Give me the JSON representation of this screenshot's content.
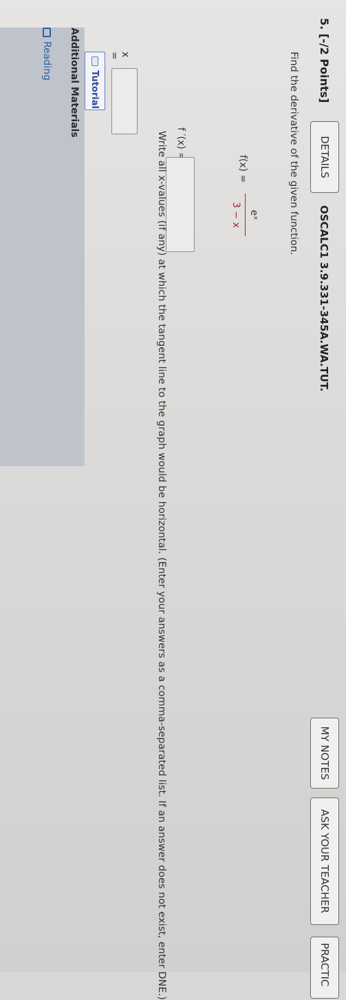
{
  "question": {
    "number_label": "5.  [-/2 Points]",
    "details_label": "DETAILS",
    "code": "OSCALC1 3.9.331-345A.WA.TUT.",
    "my_notes_label": "MY NOTES",
    "ask_teacher_label": "ASK YOUR TEACHER",
    "practice_label": "PRACTIC"
  },
  "problem": {
    "prompt": "Find the derivative of the given function.",
    "fx_label": "f(x) =",
    "numerator": "eˣ",
    "denominator": "3 − x",
    "fprime_label": "f ′(x) =",
    "fprime_value": "",
    "write_prompt": "Write all x-values (if any) at which the tangent line to the graph would be horizontal. (Enter your answers as a comma-separated list. If an answer does not exist, enter DNE.)",
    "x_label": "x =",
    "x_value": "",
    "tutorial_label": "Tutorial"
  },
  "materials": {
    "title": "Additional Materials",
    "reading_label": "Reading"
  },
  "colors": {
    "accent_red": "#aa2233",
    "link_blue": "#2f5ea8",
    "materials_bg": "#bfc3cc"
  }
}
